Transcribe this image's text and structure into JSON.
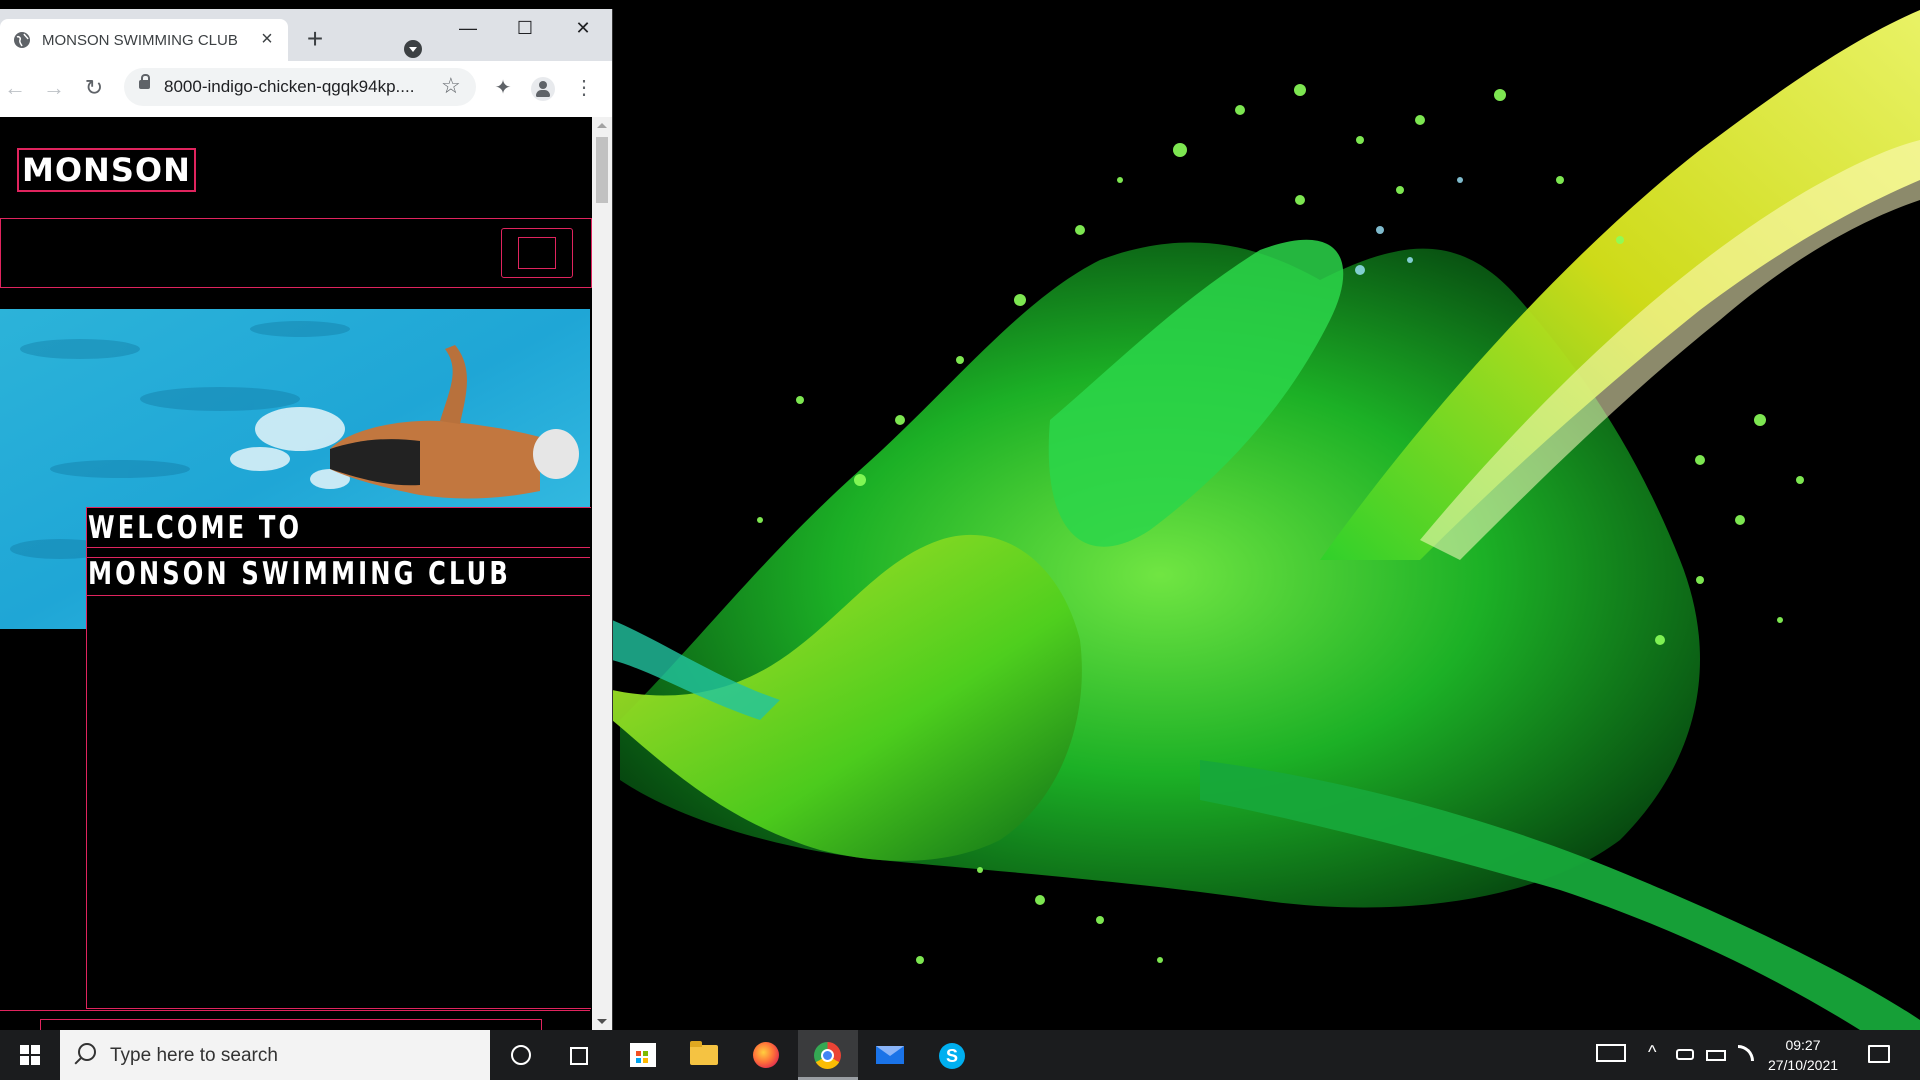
{
  "browser": {
    "tab_title": "MONSON SWIMMING CLUB",
    "tab_close": "×",
    "new_tab": "+",
    "url": "8000-indigo-chicken-qgqk94kp....",
    "window_controls": {
      "minimize": "—",
      "maximize": "☐",
      "close": "✕"
    },
    "nav": {
      "back": "←",
      "forward": "→",
      "reload": "↻",
      "star": "☆",
      "menu": "⋮",
      "extensions": "✦"
    }
  },
  "site": {
    "logo": "MONSON",
    "welcome_line1": "WELCOME TO",
    "welcome_line2": "MONSON SWIMMING CLUB",
    "accent_color": "#e0245e"
  },
  "taskbar": {
    "search_placeholder": "Type here to search",
    "time": "09:27",
    "date": "27/10/2021",
    "skype_letter": "S",
    "apps": [
      "start-icon",
      "cortana-icon",
      "task-view-icon",
      "store-icon",
      "file-explorer-icon",
      "firefox-icon",
      "chrome-icon",
      "mail-icon",
      "skype-icon"
    ]
  }
}
